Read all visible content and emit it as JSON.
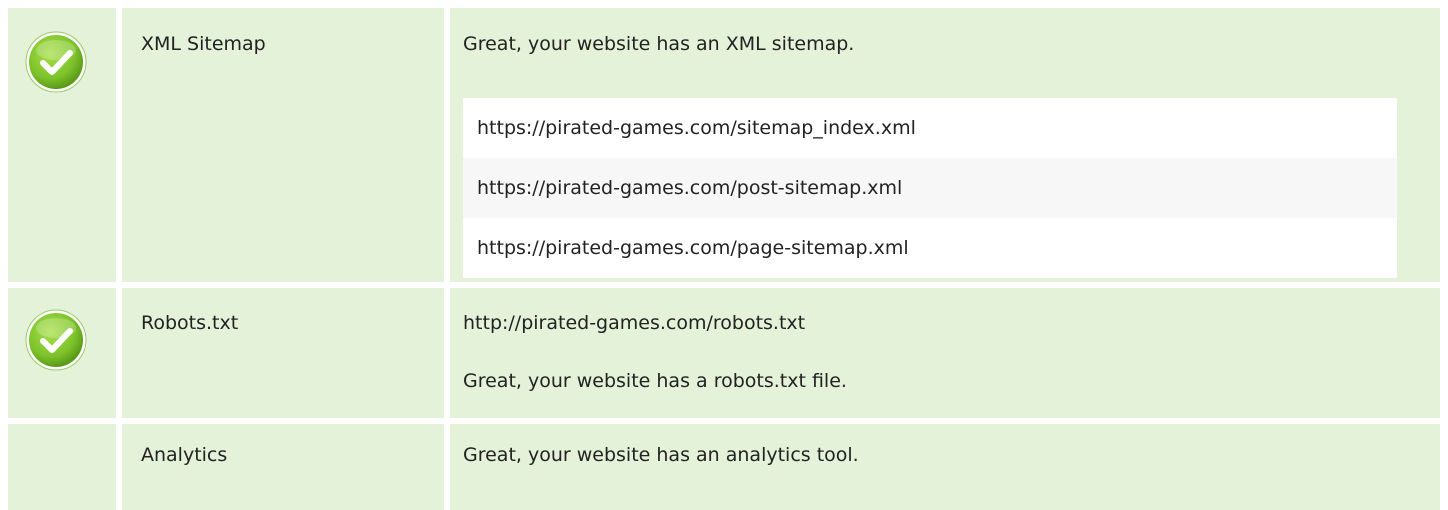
{
  "rows": [
    {
      "label": "XML Sitemap",
      "status": "pass",
      "message": "Great, your website has an XML sitemap.",
      "urls": [
        "https://pirated-games.com/sitemap_index.xml",
        "https://pirated-games.com/post-sitemap.xml",
        "https://pirated-games.com/page-sitemap.xml"
      ]
    },
    {
      "label": "Robots.txt",
      "status": "pass",
      "url": "http://pirated-games.com/robots.txt",
      "message": "Great, your website has a robots.txt file."
    },
    {
      "label": "Analytics",
      "status": "none",
      "message": "Great, your website has an analytics tool."
    }
  ],
  "icons": {
    "pass": "check-circle-icon"
  },
  "colors": {
    "row_bg": "#e3f2d8",
    "check_green": "#7cc22a"
  }
}
